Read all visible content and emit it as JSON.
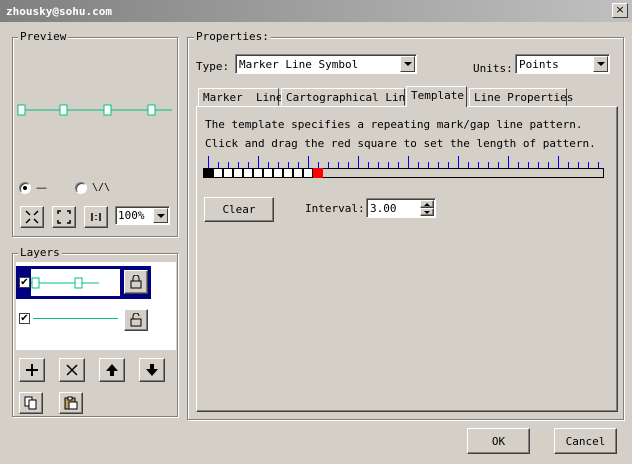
{
  "window": {
    "title": "zhousky@sohu.com",
    "close_glyph": "×"
  },
  "preview": {
    "label": "Preview",
    "line_color": "#00c080",
    "mark_glyph": "€",
    "radio_options": [
      {
        "icon": "straight-line-icon",
        "glyph": "—",
        "selected": true
      },
      {
        "icon": "zigzag-line-icon",
        "glyph": "\\/\\",
        "selected": false
      }
    ],
    "zoom": "100%"
  },
  "layers": {
    "label": "Layers",
    "items": [
      {
        "checked": true,
        "check_glyph": "✔",
        "type": "marker-line",
        "locked": true
      },
      {
        "checked": true,
        "check_glyph": "✔",
        "type": "simple-line",
        "locked": false
      }
    ]
  },
  "properties": {
    "label": "Properties:",
    "type_label": "Type:",
    "type_value": "Marker Line Symbol",
    "units_label": "Units:",
    "units_value": "Points"
  },
  "tabs": [
    {
      "label": "Marker  Line",
      "active": false
    },
    {
      "label": "Cartographical Line",
      "active": false
    },
    {
      "label": "Template",
      "active": true
    },
    {
      "label": "Line Properties",
      "active": false
    }
  ],
  "template": {
    "line1": "The template specifies a repeating mark/gap line pattern.",
    "line2": "Click and drag the red square to set the length of pattern.",
    "cells": [
      "mark",
      "gap",
      "gap",
      "gap",
      "gap",
      "gap",
      "gap",
      "gap",
      "gap",
      "gap",
      "gap",
      "end"
    ],
    "clear_label": "Clear",
    "interval_label": "Interval:",
    "interval_value": "3.00",
    "marker_color": "#ff0000",
    "tick_color": "#0000ff"
  },
  "footer": {
    "ok_label": "OK",
    "cancel_label": "Cancel"
  }
}
